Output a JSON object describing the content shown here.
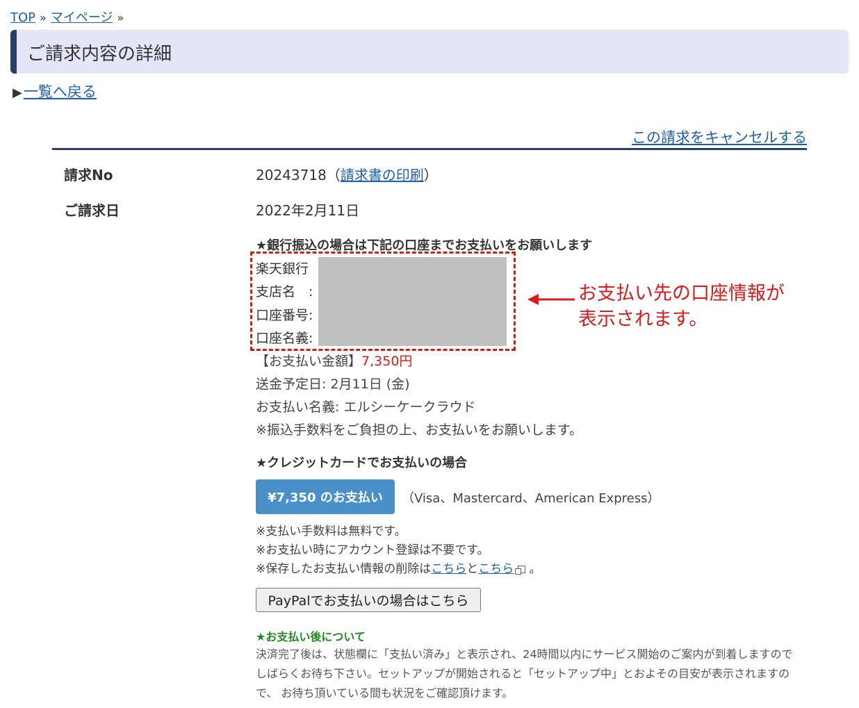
{
  "breadcrumb": {
    "top": "TOP",
    "mypage": "マイページ",
    "sep": "»"
  },
  "page_title": "ご請求内容の詳細",
  "back_link": {
    "arrow": "▶",
    "label": "一覧へ戻る"
  },
  "cancel_link": "この請求をキャンセルする",
  "invoice": {
    "no_label": "請求No",
    "no_value": "20243718",
    "print_open": "（",
    "print_link": "請求書の印刷",
    "print_close": "）",
    "date_label": "ご請求日",
    "date_value": "2022年2月11日"
  },
  "bank": {
    "heading": "★銀行振込の場合は下記の口座までお支払いをお願いします",
    "bank_name": "楽天銀行",
    "branch_label": "支店名　:",
    "account_no_label": "口座番号:",
    "account_name_label": "口座名義:"
  },
  "annotation": {
    "line1": "お支払い先の口座情報が",
    "line2": "表示されます。"
  },
  "transfer_info": {
    "amount_label": "【お支払い金額】",
    "amount_value": "7,350円",
    "date_line": "送金予定日: 2月11日 (金)",
    "payee_line": "お支払い名義: エルシーケークラウド",
    "fee_note": "※振込手数料をご負担の上、お支払いをお願いします。"
  },
  "credit": {
    "heading": "★クレジットカードでお支払いの場合",
    "pay_button": "¥7,350 のお支払い",
    "cards": "（Visa、Mastercard、American Express）",
    "note1": "※支払い手数料は無料です。",
    "note2": "※お支払い時にアカウント登録は不要です。",
    "note3_prefix": "※保存したお支払い情報の削除は",
    "note3_link1": "こちら",
    "note3_and": "と",
    "note3_link2": "こちら",
    "note3_suffix": "。"
  },
  "paypal_button": "PayPalでお支払いの場合はこちら",
  "after_payment": {
    "heading": "★お支払い後について",
    "body": "決済完了後は、状態欄に「支払い済み」と表示され、24時間以内にサービス開始のご案内が到着しますのでしばらくお待ち下さい。セットアップが開始されると「セットアップ中」とおよその目安が表示されますので、 お待ち頂いている間も状況をご確認頂けます。"
  },
  "colors": {
    "accent_navy": "#2b3d6b",
    "title_bg": "#e4e6f7",
    "link_blue": "#1a5fb4",
    "annotation_red": "#e01818",
    "pay_button_blue": "#4a90c8",
    "after_heading_green": "#1e8a1e"
  }
}
